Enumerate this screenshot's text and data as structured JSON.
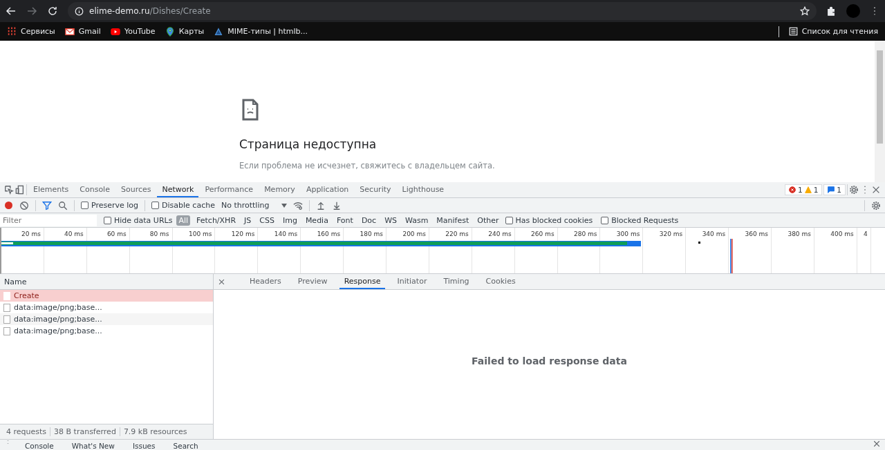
{
  "browser": {
    "url_host": "elime-demo.ru",
    "url_path": "/Dishes/Create",
    "bookmarks": [
      {
        "kind": "apps",
        "label": "Сервисы"
      },
      {
        "kind": "gmail",
        "label": "Gmail"
      },
      {
        "kind": "youtube",
        "label": "YouTube"
      },
      {
        "kind": "maps",
        "label": "Карты"
      },
      {
        "kind": "site",
        "label": "MIME-типы | htmlb..."
      }
    ],
    "reading_list": "Список для чтения"
  },
  "page": {
    "title": "Страница недоступна",
    "message": "Если проблема не исчезнет, свяжитесь с владельцем сайта."
  },
  "devtools": {
    "tabs": [
      {
        "label": "Elements",
        "selected": false
      },
      {
        "label": "Console",
        "selected": false
      },
      {
        "label": "Sources",
        "selected": false
      },
      {
        "label": "Network",
        "selected": true
      },
      {
        "label": "Performance",
        "selected": false
      },
      {
        "label": "Memory",
        "selected": false
      },
      {
        "label": "Application",
        "selected": false
      },
      {
        "label": "Security",
        "selected": false
      },
      {
        "label": "Lighthouse",
        "selected": false
      }
    ],
    "errors": "1",
    "warnings": "1",
    "messages": "1",
    "toolbar": {
      "recording": true,
      "preserve_log": {
        "label": "Preserve log",
        "checked": false
      },
      "disable_cache": {
        "label": "Disable cache",
        "checked": false
      },
      "throttling": "No throttling"
    },
    "filter": {
      "placeholder": "Filter",
      "hide_data_urls": {
        "label": "Hide data URLs",
        "checked": false
      },
      "types": [
        {
          "label": "All",
          "selected": true
        },
        {
          "label": "Fetch/XHR",
          "selected": false
        },
        {
          "label": "JS",
          "selected": false
        },
        {
          "label": "CSS",
          "selected": false
        },
        {
          "label": "Img",
          "selected": false
        },
        {
          "label": "Media",
          "selected": false
        },
        {
          "label": "Font",
          "selected": false
        },
        {
          "label": "Doc",
          "selected": false
        },
        {
          "label": "WS",
          "selected": false
        },
        {
          "label": "Wasm",
          "selected": false
        },
        {
          "label": "Manifest",
          "selected": false
        },
        {
          "label": "Other",
          "selected": false
        }
      ],
      "blocked_cookies": {
        "label": "Has blocked cookies",
        "checked": false
      },
      "blocked_requests": {
        "label": "Blocked Requests",
        "checked": false
      }
    },
    "overview_ticks": [
      "20 ms",
      "40 ms",
      "60 ms",
      "80 ms",
      "100 ms",
      "120 ms",
      "140 ms",
      "160 ms",
      "180 ms",
      "200 ms",
      "220 ms",
      "240 ms",
      "260 ms",
      "280 ms",
      "300 ms",
      "320 ms",
      "340 ms",
      "360 ms",
      "380 ms",
      "400 ms",
      "4"
    ],
    "name_header": "Name",
    "requests": [
      {
        "name": "Create",
        "selected": true,
        "failed": true
      },
      {
        "name": "data:image/png;base...",
        "selected": false,
        "failed": false
      },
      {
        "name": "data:image/png;base...",
        "selected": false,
        "failed": false
      },
      {
        "name": "data:image/png;base...",
        "selected": false,
        "failed": false
      }
    ],
    "detail_tabs": [
      {
        "label": "Headers",
        "selected": false
      },
      {
        "label": "Preview",
        "selected": false
      },
      {
        "label": "Response",
        "selected": true
      },
      {
        "label": "Initiator",
        "selected": false
      },
      {
        "label": "Timing",
        "selected": false
      },
      {
        "label": "Cookies",
        "selected": false
      }
    ],
    "response_message": "Failed to load response data",
    "status": [
      "4 requests",
      "38 B transferred",
      "7.9 kB resources"
    ],
    "drawer_tabs": [
      {
        "label": "Console",
        "selected": false
      },
      {
        "label": "What's New",
        "selected": false
      },
      {
        "label": "Issues",
        "selected": false
      },
      {
        "label": "Search",
        "selected": false
      }
    ]
  }
}
